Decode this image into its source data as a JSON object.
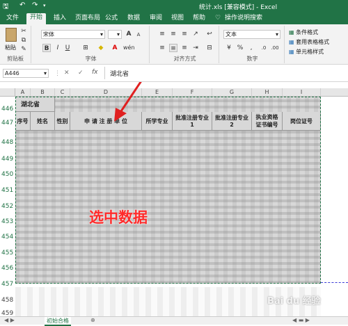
{
  "titlebar": {
    "title": "统计.xls  [兼容模式]  -  Excel"
  },
  "tabs": [
    "文件",
    "开始",
    "插入",
    "页面布局",
    "公式",
    "数据",
    "审阅",
    "视图",
    "帮助",
    "操作说明搜索"
  ],
  "ribbon": {
    "paste": "粘贴",
    "clipboard": "剪贴板",
    "font_name": "宋体",
    "font_group": "字体",
    "align_group": "对齐方式",
    "number_format": "文本",
    "number_group": "数字",
    "cond_format": "条件格式",
    "table_format": "套用表格格式",
    "cell_style": "单元格样式",
    "bold": "B",
    "italic": "I",
    "underline": "U",
    "grow": "A",
    "shrink": "A"
  },
  "formula_bar": {
    "name_box": "A446",
    "cancel": "✕",
    "confirm": "✓",
    "fx": "fx",
    "value": "湖北省"
  },
  "columns": [
    "A",
    "B",
    "C",
    "D",
    "E",
    "F",
    "G",
    "H",
    "I"
  ],
  "rows": [
    "446",
    "447",
    "448",
    "449",
    "450",
    "451",
    "452",
    "453",
    "454",
    "455",
    "456",
    "457",
    "458",
    "459"
  ],
  "table": {
    "province": "湖北省",
    "headers": [
      "序号",
      "姓名",
      "性别",
      "申 请 注 册 单 位",
      "所学专业",
      "批准注册专业1",
      "批准注册专业2",
      "执业资格证书编号",
      "岗位证号"
    ]
  },
  "annotation": "选中数据",
  "watermark": "Bai du 经验",
  "status": {
    "sheet_tab": "初始合格"
  },
  "colors": {
    "excel_green": "#217346",
    "annotation_red": "#ff2a2a",
    "arrow_red": "#e02020",
    "selection": "#d8d8d8"
  }
}
